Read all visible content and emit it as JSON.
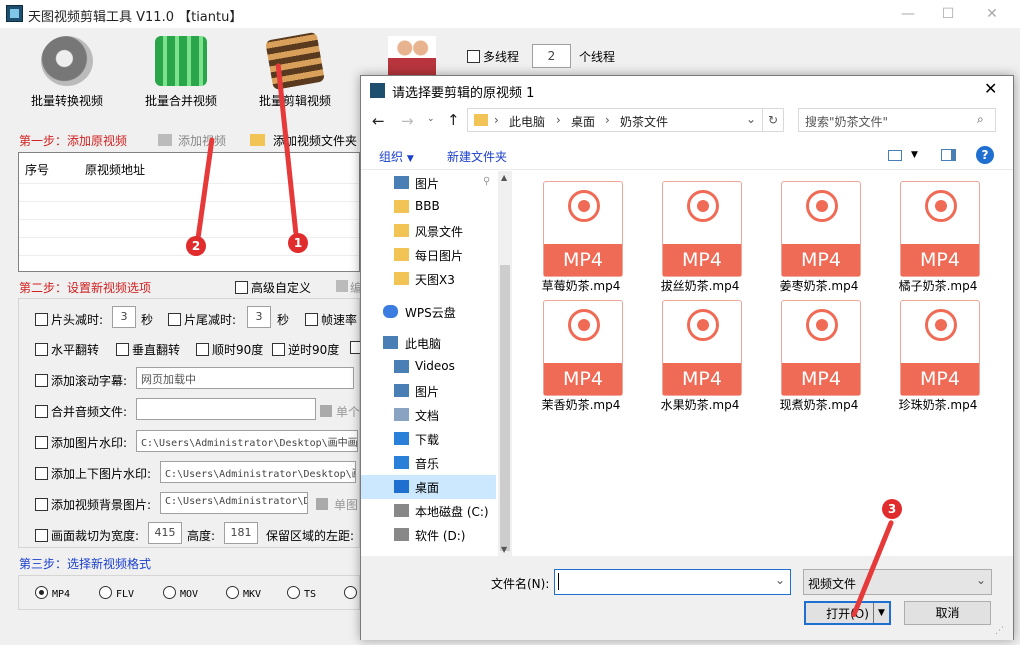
{
  "app": {
    "title": "天图视频剪辑工具 V11.0  【tiantu】",
    "toolbar": [
      {
        "label": "批量转换视频",
        "icon": "film-reel-convert-icon"
      },
      {
        "label": "批量合并视频",
        "icon": "building-merge-icon"
      },
      {
        "label": "批量剪辑视频",
        "icon": "film-strip-scissors-icon"
      },
      {
        "label": "",
        "icon": "users-icon"
      }
    ],
    "multithread": {
      "label": "多线程",
      "count": "2",
      "suffix": "个线程"
    },
    "step1": {
      "title": "第一步：添加原视频",
      "add_video": "添加视频",
      "add_folder": "添加视频文件夹"
    },
    "table": {
      "columns": [
        "序号",
        "原视频地址"
      ]
    },
    "step2": {
      "title": "第二步：设置新视频选项",
      "advanced": "高级自定义",
      "adv_trail": "编"
    },
    "options": {
      "head_trim": "片头减时:",
      "head_val": "3",
      "sec1": "秒",
      "tail_trim": "片尾减时:",
      "tail_val": "3",
      "sec2": "秒",
      "framerate": "帧速率",
      "hflip": "水平翻转",
      "vflip": "垂直翻转",
      "cw90": "顺时90度",
      "ccw90": "逆时90度",
      "scroll_text": "添加滚动字幕:",
      "scroll_val": "网页加载中",
      "merge_audio": "合并音频文件:",
      "single_label": "单个",
      "img_watermark": "添加图片水印:",
      "img_watermark_val": "C:\\Users\\Administrator\\Desktop\\画中画",
      "tb_watermark": "添加上下图片水印:",
      "tb_watermark_val": "C:\\Users\\Administrator\\Desktop\\画",
      "bg_image": "添加视频背景图片:",
      "bg_image_val": "C:\\Users\\Administrator\\De",
      "single_image": "单图",
      "crop": "画面裁切为宽度:",
      "crop_w": "415",
      "height_label": "高度:",
      "crop_h": "181",
      "keep_left": "保留区域的左距:"
    },
    "step3": {
      "title": "第三步：选择新视频格式",
      "formats": [
        "MP4",
        "FLV",
        "MOV",
        "MKV",
        "TS"
      ]
    }
  },
  "dialog": {
    "title": "请选择要剪辑的原视频 1",
    "breadcrumb": [
      "此电脑",
      "桌面",
      "奶茶文件"
    ],
    "search_placeholder": "搜索\"奶茶文件\"",
    "organize": "组织",
    "new_folder": "新建文件夹",
    "tree": [
      {
        "label": "图片",
        "icon": "pictures-icon"
      },
      {
        "label": "BBB",
        "icon": "folder-icon"
      },
      {
        "label": "风景文件",
        "icon": "folder-icon"
      },
      {
        "label": "每日图片",
        "icon": "folder-icon"
      },
      {
        "label": "天图X3",
        "icon": "folder-icon"
      },
      {
        "label": "WPS云盘",
        "icon": "cloud-icon"
      },
      {
        "label": "此电脑",
        "icon": "computer-icon"
      },
      {
        "label": "Videos",
        "icon": "videos-icon"
      },
      {
        "label": "图片",
        "icon": "pictures-icon"
      },
      {
        "label": "文档",
        "icon": "documents-icon"
      },
      {
        "label": "下载",
        "icon": "download-icon"
      },
      {
        "label": "音乐",
        "icon": "music-icon"
      },
      {
        "label": "桌面",
        "icon": "desktop-icon"
      },
      {
        "label": "本地磁盘 (C:)",
        "icon": "drive-icon"
      },
      {
        "label": "软件 (D:)",
        "icon": "drive-icon"
      }
    ],
    "files": [
      {
        "name": "草莓奶茶.mp4",
        "badge": "MP4"
      },
      {
        "name": "拔丝奶茶.mp4",
        "badge": "MP4"
      },
      {
        "name": "姜枣奶茶.mp4",
        "badge": "MP4"
      },
      {
        "name": "橘子奶茶.mp4",
        "badge": "MP4"
      },
      {
        "name": "茉香奶茶.mp4",
        "badge": "MP4"
      },
      {
        "name": "水果奶茶.mp4",
        "badge": "MP4"
      },
      {
        "name": "现煮奶茶.mp4",
        "badge": "MP4"
      },
      {
        "name": "珍珠奶茶.mp4",
        "badge": "MP4"
      }
    ],
    "filename_label": "文件名(N):",
    "filename_value": "",
    "filetype": "视频文件",
    "open": "打开(O)",
    "cancel": "取消"
  },
  "annotations": [
    "1",
    "2",
    "3"
  ]
}
